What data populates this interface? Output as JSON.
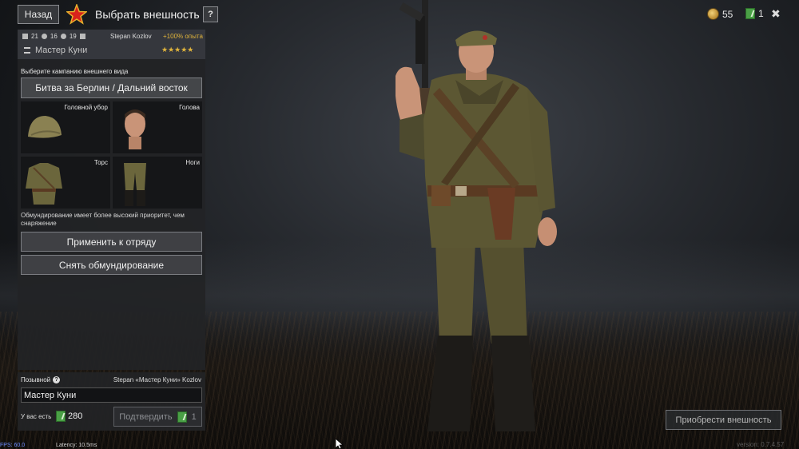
{
  "topbar": {
    "back_label": "Назад",
    "title": "Выбрать внешность",
    "help_label": "?",
    "gold": "55",
    "tickets": "1",
    "close_label": "✖"
  },
  "soldier_card": {
    "stat1": "21",
    "stat2": "16",
    "stat3": "19",
    "name": "Stepan Kozlov",
    "xp_bonus": "+100% опыта",
    "callsign": "Мастер Куни",
    "stars": "★★★★★"
  },
  "campaign": {
    "label": "Выберите кампанию внешнего вида",
    "selected": "Битва за Берлин / Дальний восток"
  },
  "slots": [
    {
      "label": "Головной убор"
    },
    {
      "label": "Голова"
    },
    {
      "label": "Торс"
    },
    {
      "label": "Ноги"
    }
  ],
  "priority_note": "Обмундирование имеет более высокий приоритет, чем снаряжение",
  "actions": {
    "apply_label": "Применить к отряду",
    "remove_label": "Снять обмундирование"
  },
  "callsign_panel": {
    "label": "Позывной",
    "full_name": "Stepan «Мастер Куни» Kozlov",
    "input_value": "Мастер Куни",
    "have_label": "У вас есть",
    "have_value": "280",
    "confirm_label": "Подтвердить",
    "confirm_cost": "1"
  },
  "buy_label": "Приобрести внешность",
  "debug": {
    "fps": "FPS: 60.0",
    "latency": "Latency: 10.5ms",
    "version": "version: 0.7.4.57"
  },
  "colors": {
    "accent_gold": "#e0b43c",
    "ticket_green": "#4aa046",
    "panel_bg": "#222326"
  }
}
